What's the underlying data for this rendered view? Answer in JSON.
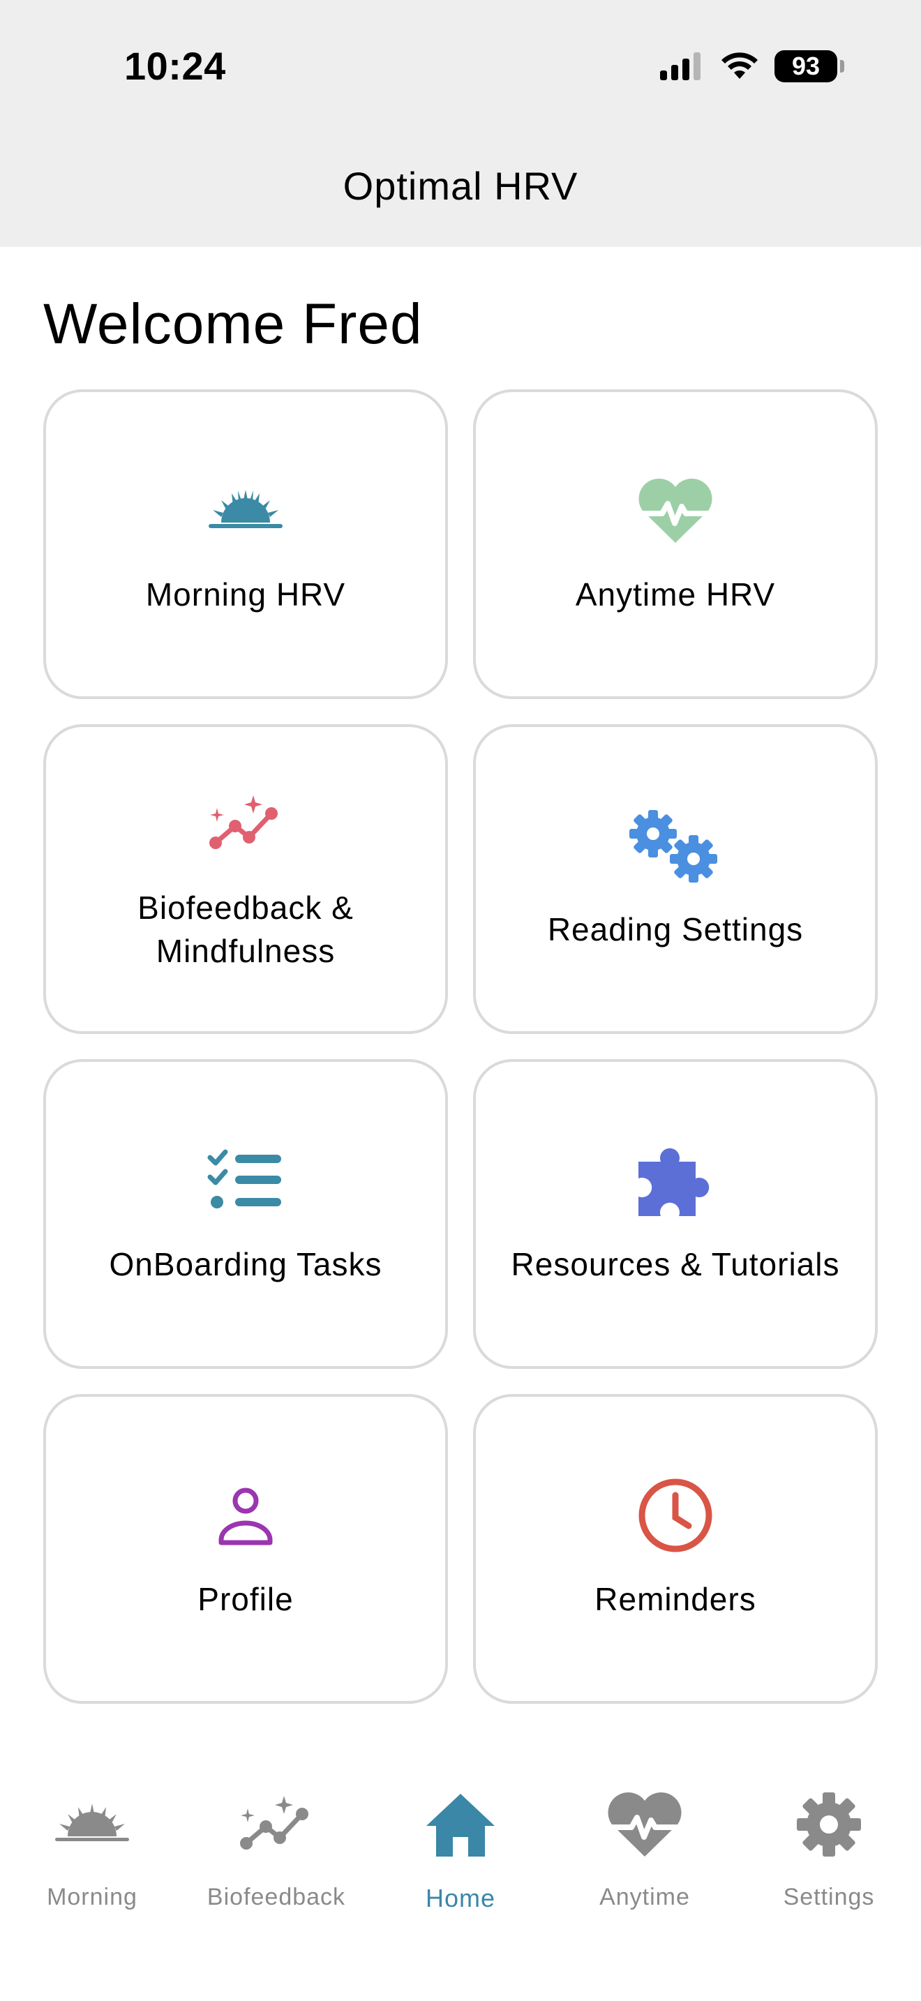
{
  "status_bar": {
    "time": "10:24",
    "battery": "93"
  },
  "header": {
    "title": "Optimal HRV"
  },
  "welcome": "Welcome Fred",
  "cards": [
    {
      "label": "Morning HRV",
      "icon": "sunrise-icon",
      "color": "#3b8aa6"
    },
    {
      "label": "Anytime HRV",
      "icon": "heartbeat-icon",
      "color": "#9ccfa6"
    },
    {
      "label": "Biofeedback & Mindfulness",
      "icon": "sparkle-trend-icon",
      "color": "#e06070"
    },
    {
      "label": "Reading Settings",
      "icon": "gears-icon",
      "color": "#4a8fe0"
    },
    {
      "label": "OnBoarding Tasks",
      "icon": "checklist-icon",
      "color": "#3b8aa6"
    },
    {
      "label": "Resources & Tutorials",
      "icon": "puzzle-icon",
      "color": "#5c6fd6"
    },
    {
      "label": "Profile",
      "icon": "person-icon",
      "color": "#9b35b0"
    },
    {
      "label": "Reminders",
      "icon": "clock-icon",
      "color": "#d95546"
    }
  ],
  "tabs": [
    {
      "label": "Morning",
      "icon": "sunrise-icon",
      "active": false
    },
    {
      "label": "Biofeedback",
      "icon": "sparkle-trend-icon",
      "active": false
    },
    {
      "label": "Home",
      "icon": "home-icon",
      "active": true
    },
    {
      "label": "Anytime",
      "icon": "heartbeat-icon",
      "active": false
    },
    {
      "label": "Settings",
      "icon": "gear-icon",
      "active": false
    }
  ],
  "colors": {
    "header_bg": "#eeeeee",
    "active_tab": "#3a87a7",
    "inactive_tab": "#8a8a8a",
    "card_border": "#dadada"
  }
}
